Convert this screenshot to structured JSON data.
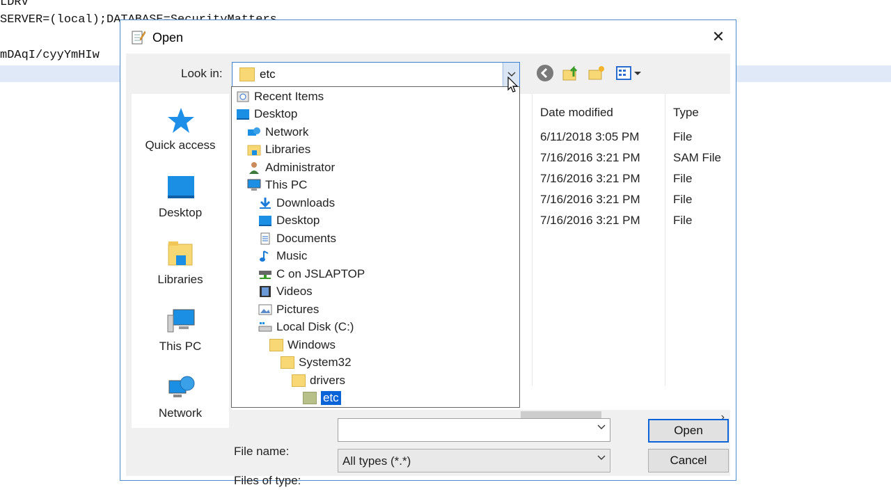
{
  "background_text": {
    "line1": "LDRV",
    "line2": "SERVER=(local);DATABASE=SecurityMatters",
    "line3": "mDAqI/cyyYmHIw"
  },
  "dialog": {
    "title": "Open",
    "close_glyph": "✕",
    "look_in_label": "Look in:",
    "look_in_value": "etc",
    "places": [
      {
        "label": "Quick access",
        "icon": "quick-access-icon"
      },
      {
        "label": "Desktop",
        "icon": "desktop-icon"
      },
      {
        "label": "Libraries",
        "icon": "libraries-icon"
      },
      {
        "label": "This PC",
        "icon": "this-pc-icon"
      },
      {
        "label": "Network",
        "icon": "network-icon"
      }
    ],
    "columns": {
      "date": "Date modified",
      "type": "Type"
    },
    "files": [
      {
        "date": "6/11/2018 3:05 PM",
        "type": "File"
      },
      {
        "date": "7/16/2016 3:21 PM",
        "type": "SAM File"
      },
      {
        "date": "7/16/2016 3:21 PM",
        "type": "File"
      },
      {
        "date": "7/16/2016 3:21 PM",
        "type": "File"
      },
      {
        "date": "7/16/2016 3:21 PM",
        "type": "File"
      }
    ],
    "dropdown_items": [
      {
        "label": "Recent Items",
        "icon": "recent-items-icon"
      },
      {
        "label": "Desktop",
        "icon": "desktop-icon"
      },
      {
        "label": "Network",
        "icon": "network-icon"
      },
      {
        "label": "Libraries",
        "icon": "libraries-icon"
      },
      {
        "label": "Administrator",
        "icon": "user-icon"
      },
      {
        "label": "This PC",
        "icon": "this-pc-icon"
      },
      {
        "label": "Downloads",
        "icon": "downloads-icon"
      },
      {
        "label": "Desktop",
        "icon": "desktop-icon"
      },
      {
        "label": "Documents",
        "icon": "documents-icon"
      },
      {
        "label": "Music",
        "icon": "music-icon"
      },
      {
        "label": "C on JSLAPTOP",
        "icon": "network-drive-icon"
      },
      {
        "label": "Videos",
        "icon": "videos-icon"
      },
      {
        "label": "Pictures",
        "icon": "pictures-icon"
      },
      {
        "label": "Local Disk (C:)",
        "icon": "local-disk-icon"
      },
      {
        "label": "Windows",
        "icon": "folder-icon"
      },
      {
        "label": "System32",
        "icon": "folder-icon"
      },
      {
        "label": "drivers",
        "icon": "folder-icon"
      },
      {
        "label": "etc",
        "icon": "folder-icon",
        "selected": true
      }
    ],
    "file_name_label": "File name:",
    "file_name_value": "",
    "files_of_type_label": "Files of type:",
    "files_of_type_value": "All types (*.*)",
    "open_button": "Open",
    "cancel_button": "Cancel",
    "scroll_right_glyph": "›"
  }
}
